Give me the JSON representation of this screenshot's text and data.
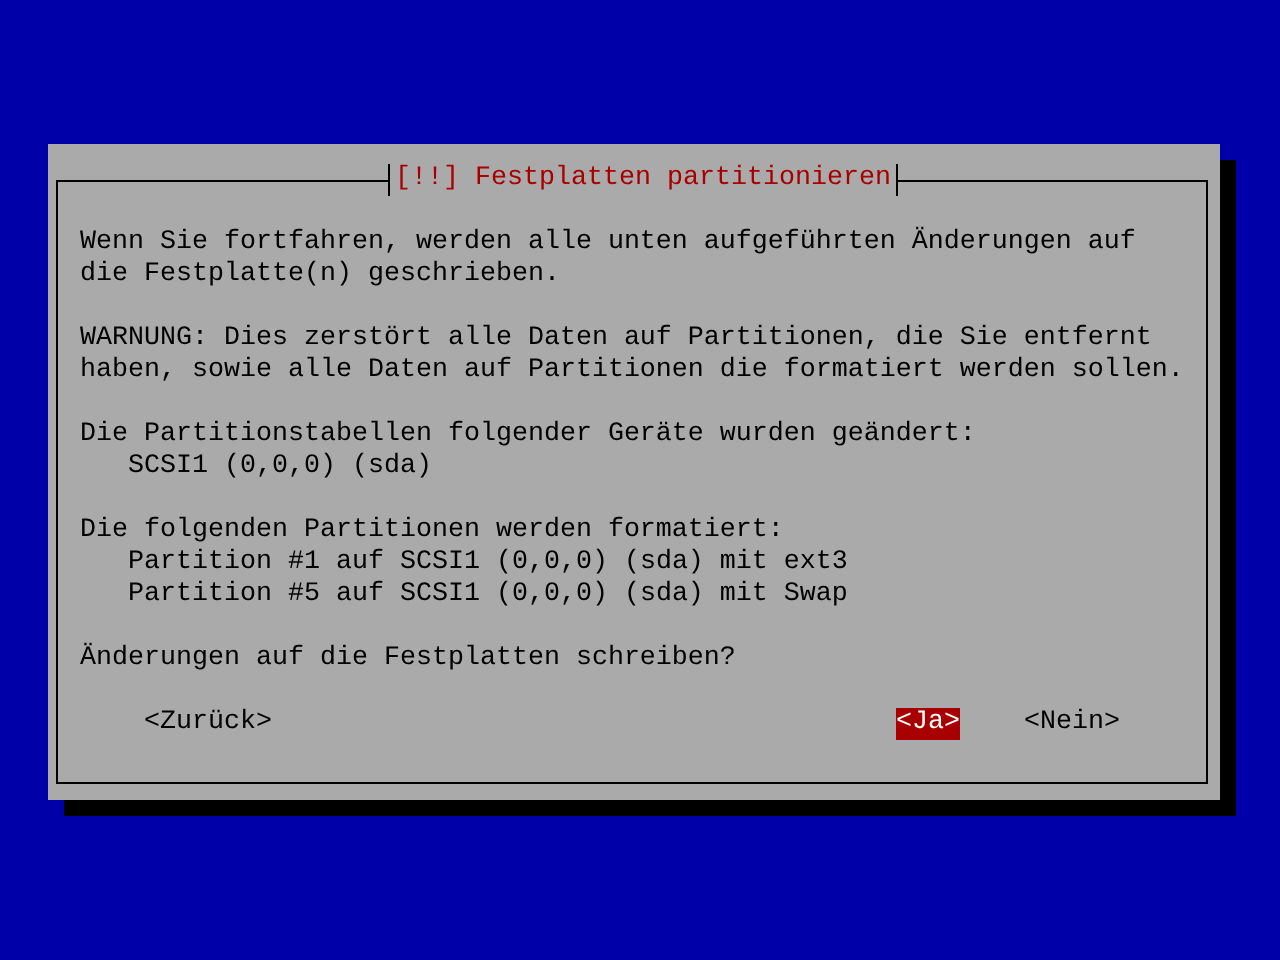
{
  "dialog": {
    "title": "[!!] Festplatten partitionieren",
    "sections": [
      {
        "text": "Wenn Sie fortfahren, werden alle unten aufgeführten Änderungen auf die Festplatte(n) geschrieben."
      },
      {
        "text": "WARNUNG: Dies zerstört alle Daten auf Partitionen, die Sie entfernt haben, sowie alle Daten auf Partitionen die formatiert werden sollen."
      },
      {
        "text": "Die Partitionstabellen folgender Geräte wurden geändert:",
        "items": [
          "SCSI1 (0,0,0) (sda)"
        ]
      },
      {
        "text": "Die folgenden Partitionen werden formatiert:",
        "items": [
          "Partition #1 auf SCSI1 (0,0,0) (sda) mit ext3",
          "Partition #5 auf SCSI1 (0,0,0) (sda) mit Swap"
        ]
      },
      {
        "text": "Änderungen auf die Festplatten schreiben?"
      }
    ],
    "buttons": [
      {
        "label": "<Zurück>",
        "selected": false
      },
      {
        "label": "<Ja>",
        "selected": true
      },
      {
        "label": "<Nein>",
        "selected": false
      }
    ]
  }
}
